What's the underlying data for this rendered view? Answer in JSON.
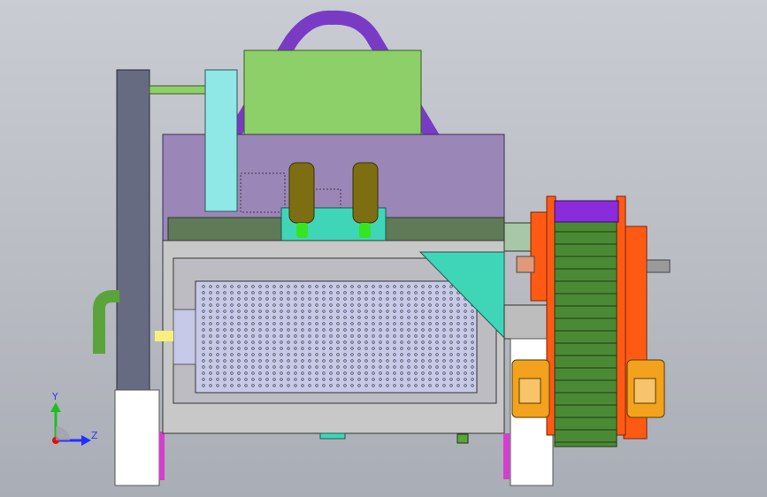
{
  "viewport": {
    "background_top": "#c9ccd2",
    "background_bottom": "#a9adb5"
  },
  "triad": {
    "y_label": "Y",
    "z_label": "Z",
    "y_color": "#1fbf1f",
    "z_color": "#2230ff",
    "origin_color": "#e01010"
  },
  "model": {
    "colors": {
      "hopper": "#8dd06a",
      "hopper_outline": "#3a5a20",
      "duct": "#7a3bc4",
      "column": "#676b82",
      "enclosure": "#9b86b8",
      "cyan_pipe": "#8fe7e6",
      "drum_frame": "#c8c8c8",
      "mesh": "#c7c9e8",
      "teal": "#3fd6b8",
      "olive": "#7d6e12",
      "green_rod": "#37e421",
      "frame_orange": "#ff5a14",
      "gear_yellow": "#f2a21c",
      "belt_green": "#4b8a34",
      "top_purple": "#8a2bdc",
      "magenta": "#d63cd0",
      "white": "#ffffff"
    }
  }
}
